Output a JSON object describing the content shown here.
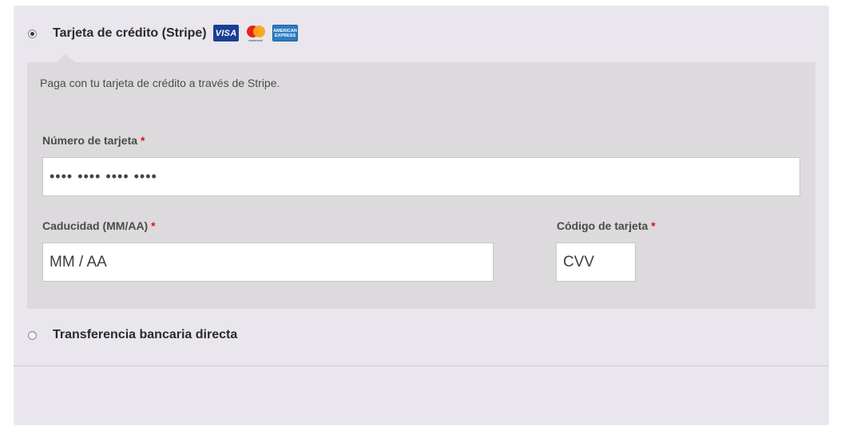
{
  "payment_methods": {
    "stripe": {
      "label": "Tarjeta de crédito (Stripe)",
      "selected": true,
      "icons": {
        "visa": "VISA",
        "mastercard_text": "mastercard",
        "amex_line1": "AMERICAN",
        "amex_line2": "EXPRESS"
      },
      "description": "Paga con tu tarjeta de crédito a través de Stripe.",
      "card_number": {
        "label": "Número de tarjeta",
        "required_mark": "*",
        "value": "•••• •••• •••• ••••"
      },
      "expiry": {
        "label": "Caducidad (MM/AA)",
        "required_mark": "*",
        "placeholder": "MM / AA"
      },
      "cvc": {
        "label": "Código de tarjeta",
        "required_mark": "*",
        "placeholder": "CVV"
      }
    },
    "bacs": {
      "label": "Transferencia bancaria directa",
      "selected": false
    }
  },
  "colors": {
    "panel_bg": "#e9e6ed",
    "box_bg": "#dcdadc",
    "required": "#dd1111",
    "visa_blue": "#1a3f95",
    "amex_blue": "#2c7cc2"
  }
}
